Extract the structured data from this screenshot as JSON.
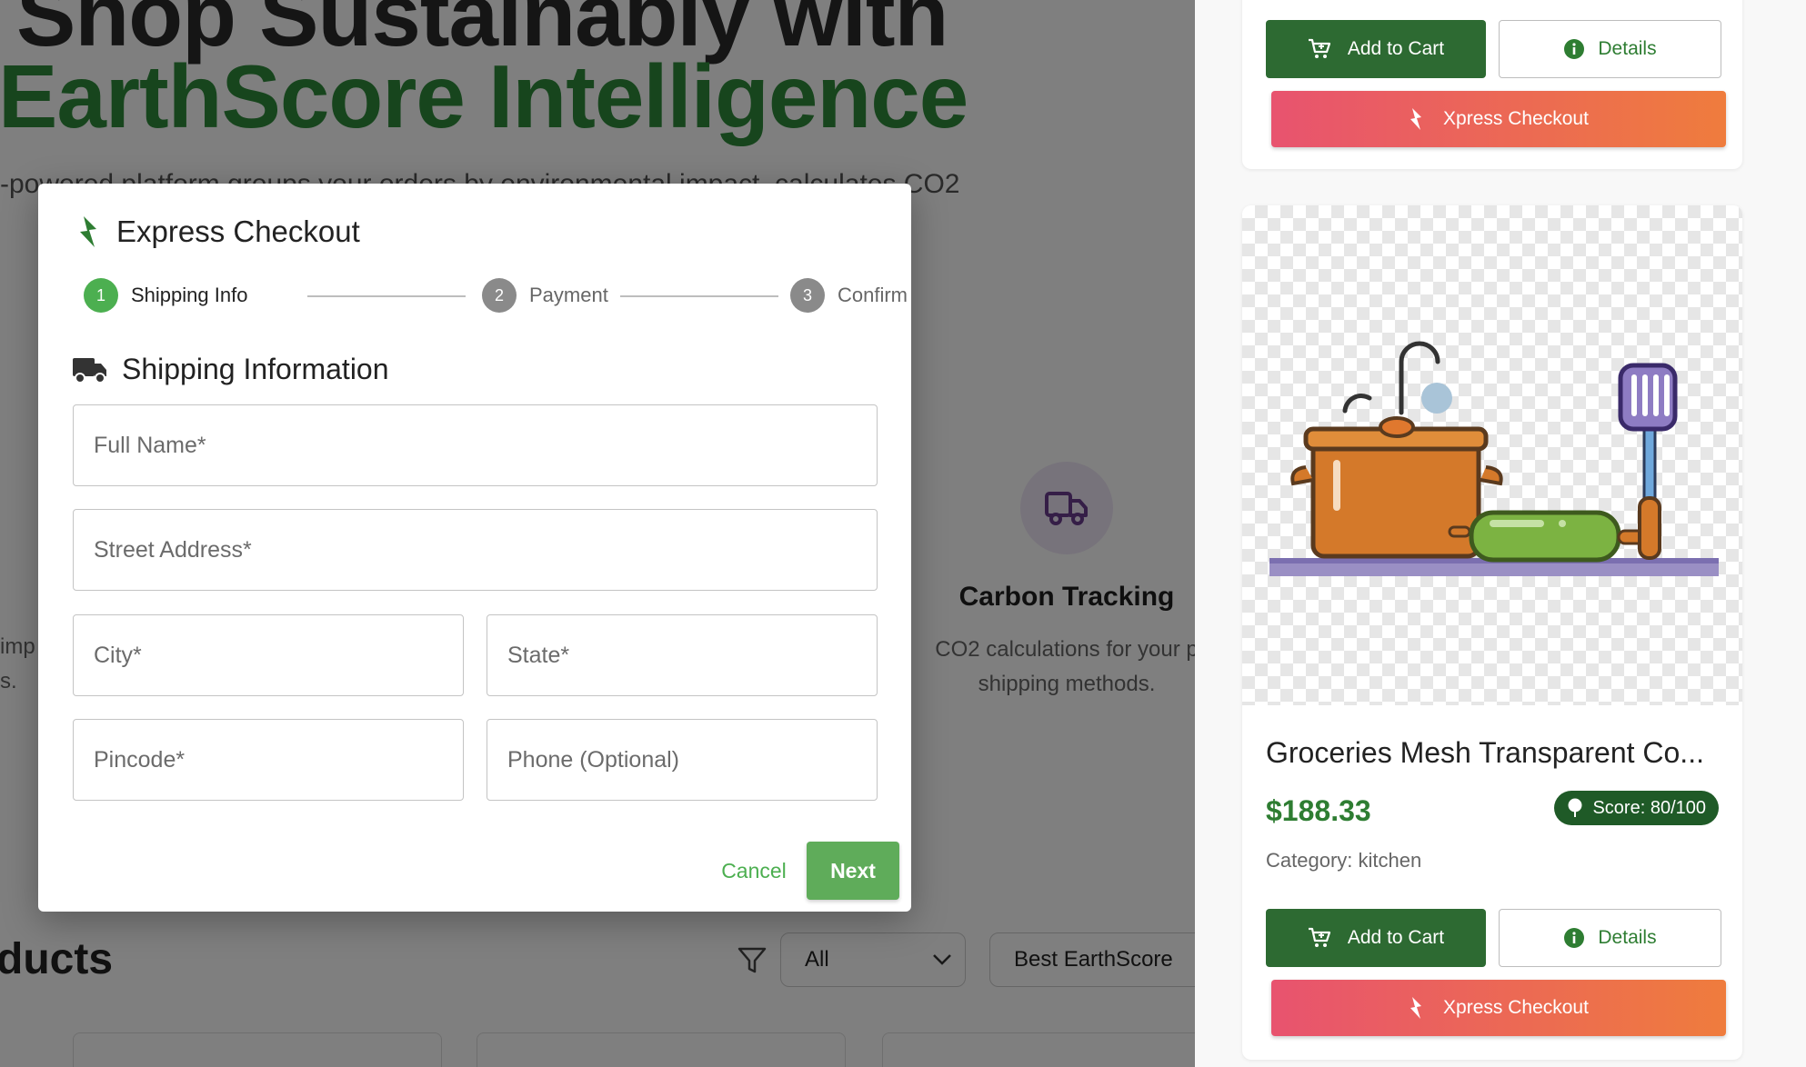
{
  "background_page": {
    "hero": {
      "line1": "Shop Sustainably with",
      "line2": "EarthScore Intelligence",
      "subtitle": "-powered platform groups your orders by environmental impact, calculates CO2"
    },
    "feature": {
      "icon": "truck-icon",
      "title": "Carbon Tracking",
      "desc_line1": "CO2 calculations for your p",
      "desc_line2": "shipping methods."
    },
    "left_fragment_line1": "imp",
    "left_fragment_line2": "s.",
    "products_heading": "ducts",
    "filter": {
      "category_value": "All",
      "sort_value": "Best EarthScore"
    }
  },
  "sidebar": {
    "card1": {
      "add_to_cart": "Add to Cart",
      "details": "Details",
      "xpress": "Xpress Checkout"
    },
    "card2": {
      "title": "Groceries Mesh Transparent Co...",
      "price": "$188.33",
      "score": "Score: 80/100",
      "category": "Category: kitchen",
      "add_to_cart": "Add to Cart",
      "details": "Details",
      "xpress": "Xpress Checkout"
    }
  },
  "modal": {
    "title": "Express Checkout",
    "steps": [
      {
        "number": "1",
        "label": "Shipping Info",
        "state": "active"
      },
      {
        "number": "2",
        "label": "Payment",
        "state": "inactive"
      },
      {
        "number": "3",
        "label": "Confirm",
        "state": "inactive"
      }
    ],
    "section_title": "Shipping Information",
    "fields": {
      "full_name": {
        "placeholder": "Full Name*",
        "value": ""
      },
      "street": {
        "placeholder": "Street Address*",
        "value": ""
      },
      "city": {
        "placeholder": "City*",
        "value": ""
      },
      "state": {
        "placeholder": "State*",
        "value": ""
      },
      "pincode": {
        "placeholder": "Pincode*",
        "value": ""
      },
      "phone": {
        "placeholder": "Phone (Optional)",
        "value": ""
      }
    },
    "cancel_label": "Cancel",
    "next_label": "Next"
  },
  "colors": {
    "primary_green": "#2e7d32",
    "dark_green": "#2d6a32",
    "step_active": "#4caf50",
    "step_inactive": "#8a8a8a",
    "xpress_gradient_start": "#e8536f",
    "xpress_gradient_end": "#ef7c3d"
  }
}
